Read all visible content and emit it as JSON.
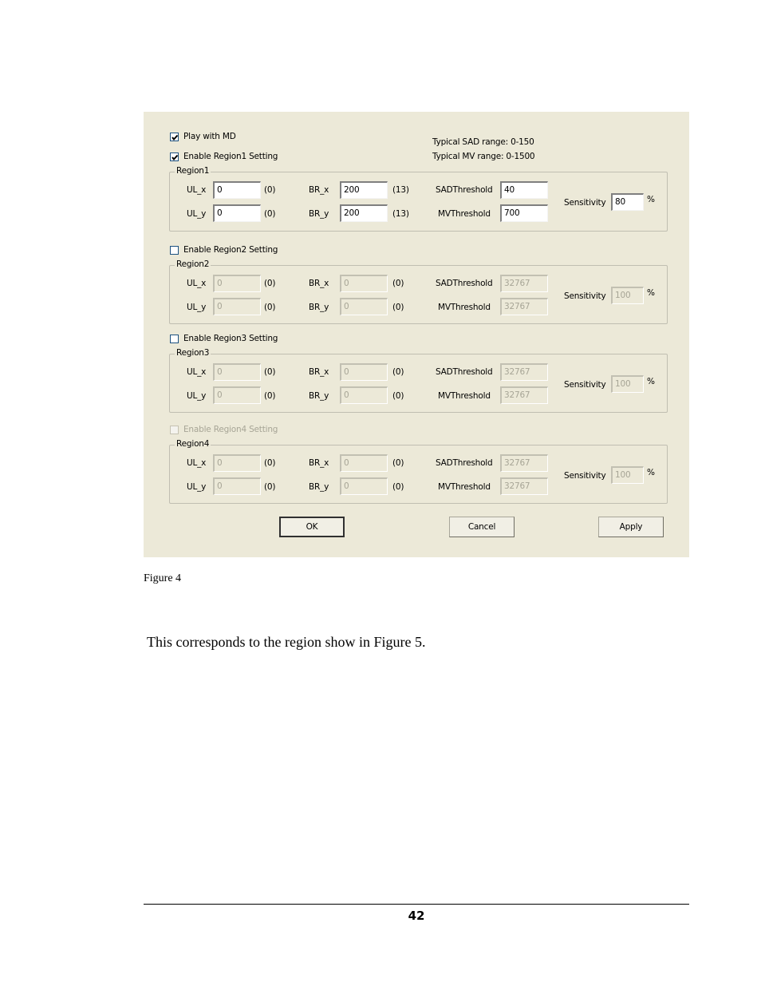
{
  "dialog": {
    "play_with_md": {
      "label": "Play with MD",
      "checked": true
    },
    "info": {
      "sad_range": "Typical SAD range: 0-150",
      "mv_range": "Typical MV range: 0-1500"
    },
    "labels": {
      "ul_x": "UL_x",
      "ul_y": "UL_y",
      "br_x": "BR_x",
      "br_y": "BR_y",
      "sad_threshold": "SADThreshold",
      "mv_threshold": "MVThreshold",
      "sensitivity": "Sensitivity",
      "percent": "%"
    },
    "regions": [
      {
        "enable_label": "Enable Region1 Setting",
        "enabled_checked": true,
        "checkbox_disabled": false,
        "fields_disabled": false,
        "group_title": "Region1",
        "ul_x": "0",
        "ul_x_hint": "(0)",
        "ul_y": "0",
        "ul_y_hint": "(0)",
        "br_x": "200",
        "br_x_hint": "(13)",
        "br_y": "200",
        "br_y_hint": "(13)",
        "sad_threshold": "40",
        "mv_threshold": "700",
        "sensitivity": "80"
      },
      {
        "enable_label": "Enable Region2 Setting",
        "enabled_checked": false,
        "checkbox_disabled": false,
        "fields_disabled": true,
        "group_title": "Region2",
        "ul_x": "0",
        "ul_x_hint": "(0)",
        "ul_y": "0",
        "ul_y_hint": "(0)",
        "br_x": "0",
        "br_x_hint": "(0)",
        "br_y": "0",
        "br_y_hint": "(0)",
        "sad_threshold": "32767",
        "mv_threshold": "32767",
        "sensitivity": "100"
      },
      {
        "enable_label": "Enable Region3 Setting",
        "enabled_checked": false,
        "checkbox_disabled": false,
        "fields_disabled": true,
        "group_title": "Region3",
        "ul_x": "0",
        "ul_x_hint": "(0)",
        "ul_y": "0",
        "ul_y_hint": "(0)",
        "br_x": "0",
        "br_x_hint": "(0)",
        "br_y": "0",
        "br_y_hint": "(0)",
        "sad_threshold": "32767",
        "mv_threshold": "32767",
        "sensitivity": "100"
      },
      {
        "enable_label": "Enable Region4 Setting",
        "enabled_checked": false,
        "checkbox_disabled": true,
        "fields_disabled": true,
        "group_title": "Region4",
        "ul_x": "0",
        "ul_x_hint": "(0)",
        "ul_y": "0",
        "ul_y_hint": "(0)",
        "br_x": "0",
        "br_x_hint": "(0)",
        "br_y": "0",
        "br_y_hint": "(0)",
        "sad_threshold": "32767",
        "mv_threshold": "32767",
        "sensitivity": "100"
      }
    ],
    "buttons": {
      "ok": "OK",
      "cancel": "Cancel",
      "apply": "Apply"
    }
  },
  "document": {
    "figure_caption": "Figure 4",
    "paragraph": "This corresponds to the region show in Figure 5.",
    "page_number": "42"
  }
}
